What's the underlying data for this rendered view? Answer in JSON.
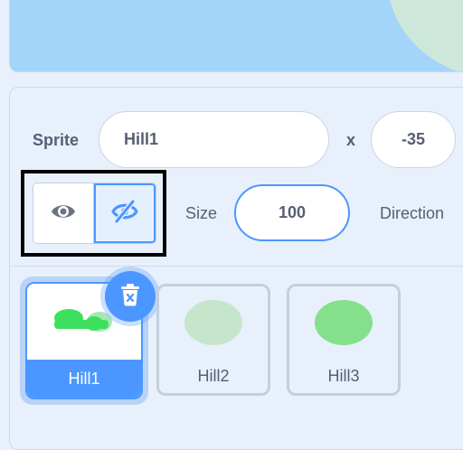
{
  "sprite_info": {
    "sprite_label": "Sprite",
    "sprite_name": "Hill1",
    "x_label": "x",
    "x_value": "-35",
    "size_label": "Size",
    "size_value": "100",
    "direction_label": "Direction",
    "visibility": "hidden"
  },
  "sprites": [
    {
      "name": "Hill1",
      "selected": true,
      "thumb_color": "#3de05e"
    },
    {
      "name": "Hill2",
      "selected": false,
      "thumb_color": "#c6e6cc"
    },
    {
      "name": "Hill3",
      "selected": false,
      "thumb_color": "#84e08a"
    }
  ],
  "icons": {
    "show": "eye-icon",
    "hide": "eye-slash-icon",
    "delete": "trash-icon"
  },
  "colors": {
    "accent": "#4c97ff",
    "stage_sky": "#a3d4f9",
    "panel_bg": "#e8f0fc",
    "text": "#575e75"
  }
}
